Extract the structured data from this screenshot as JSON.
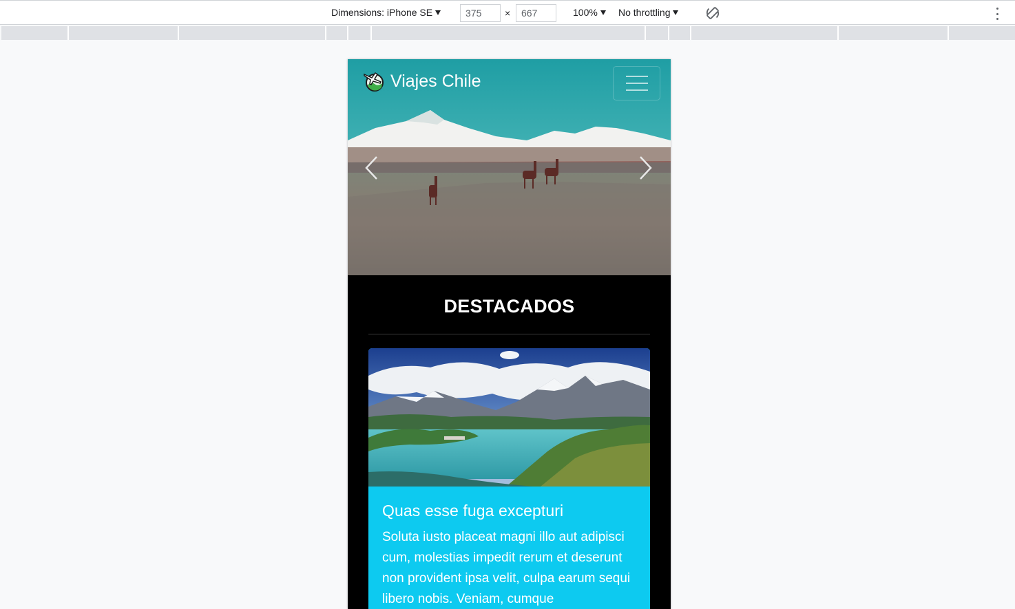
{
  "devtools": {
    "dimensions_label": "Dimensions: iPhone SE",
    "width_value": "375",
    "height_value": "667",
    "times_symbol": "×",
    "zoom": "100%",
    "throttling": "No throttling",
    "icons": [
      "rotate-icon",
      "more-options-icon"
    ]
  },
  "site": {
    "brand": "Viajes Chile",
    "icons": [
      "globe-plane-logo-icon",
      "menu-hamburger-icon",
      "chevron-left-icon",
      "chevron-right-icon"
    ],
    "featured_heading": "DESTACADOS",
    "card": {
      "title": "Quas esse fuga excepturi",
      "text": "Soluta iusto placeat magni illo aut adipisci cum, molestias impedit rerum et deserunt non provident ipsa velit, culpa earum sequi libero nobis. Veniam, cumque"
    },
    "colors": {
      "card_background": "#0dcaf0",
      "section_background": "#000000",
      "text": "#ffffff"
    }
  }
}
